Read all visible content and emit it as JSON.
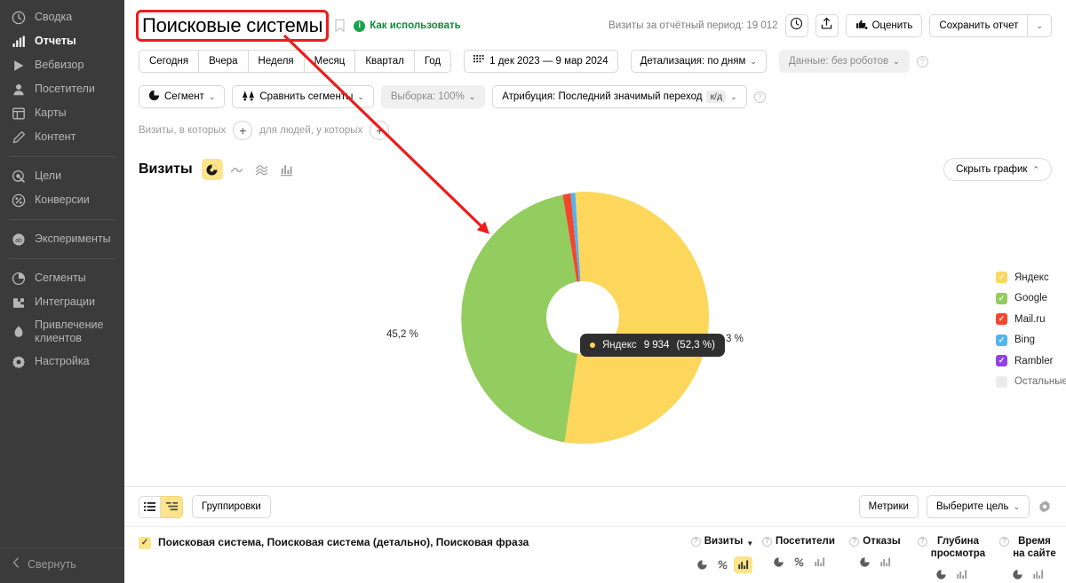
{
  "sidebar": {
    "groups": [
      {
        "items": [
          {
            "label": "Сводка",
            "icon": "summary-icon",
            "active": false
          },
          {
            "label": "Отчеты",
            "icon": "reports-icon",
            "active": true
          },
          {
            "label": "Вебвизор",
            "icon": "webvisor-icon",
            "active": false
          },
          {
            "label": "Посетители",
            "icon": "visitors-icon",
            "active": false
          },
          {
            "label": "Карты",
            "icon": "maps-icon",
            "active": false
          },
          {
            "label": "Контент",
            "icon": "content-icon",
            "active": false
          }
        ]
      },
      {
        "items": [
          {
            "label": "Цели",
            "icon": "goals-icon",
            "active": false
          },
          {
            "label": "Конверсии",
            "icon": "conversions-icon",
            "active": false
          }
        ]
      },
      {
        "items": [
          {
            "label": "Эксперименты",
            "icon": "experiments-icon",
            "active": false
          }
        ]
      },
      {
        "items": [
          {
            "label": "Сегменты",
            "icon": "segments-icon",
            "active": false
          },
          {
            "label": "Интеграции",
            "icon": "integrations-icon",
            "active": false
          },
          {
            "label": "Привлечение\nклиентов",
            "icon": "acquisition-icon",
            "active": false
          },
          {
            "label": "Настройка",
            "icon": "settings-icon",
            "active": false
          }
        ]
      }
    ],
    "collapse_label": "Свернуть"
  },
  "header": {
    "title": "Поисковые системы",
    "title_highlighted": true,
    "bookmark_icon": "bookmark-icon",
    "howto_label": "Как использовать",
    "info_badge": "i",
    "visits_summary": "Визиты за отчётный период: 19 012",
    "history_icon": "clock-icon",
    "export_icon": "export-icon",
    "rate_label": "Оценить",
    "rate_icon": "thumbs-icon",
    "save_report_label": "Сохранить отчет",
    "save_report_caret": "⌄"
  },
  "toolbar": {
    "periods": [
      "Сегодня",
      "Вчера",
      "Неделя",
      "Месяц",
      "Квартал",
      "Год"
    ],
    "date_range": "1 дек 2023 — 9 мар 2024",
    "date_icon": "calendar-icon",
    "detail_label": "Детализация: по дням",
    "data_label": "Данные: без роботов",
    "help_icon": "question-icon"
  },
  "segments": {
    "segment_label": "Сегмент",
    "segment_icon": "segment-pie-icon",
    "compare_label": "Сравнить сегменты",
    "compare_icon": "compare-icon",
    "sample_label": "Выборка: 100%",
    "attribution_label": "Атрибуция: Последний значимый переход",
    "attribution_chip": "к/д",
    "help_icon": "question-icon",
    "filter_visits_label": "Визиты, в которых",
    "filter_people_label": "для людей, у которых",
    "add_icon": "plus-icon"
  },
  "chart_header": {
    "metric_label": "Визиты",
    "viz_modes": [
      {
        "name": "pie-chart-icon",
        "active": true
      },
      {
        "name": "line-chart-icon",
        "active": false
      },
      {
        "name": "area-chart-icon",
        "active": false
      },
      {
        "name": "bar-chart-icon",
        "active": false
      }
    ],
    "hide_chart_label": "Скрыть график",
    "hide_chart_caret": "⌃"
  },
  "chart_data": {
    "type": "pie",
    "title": "Визиты",
    "variant": "donut",
    "total_visits": 19012,
    "categories": [
      "Яндекс",
      "Google",
      "Mail.ru",
      "Bing",
      "Rambler",
      "Остальные"
    ],
    "values": [
      9934,
      8593,
      190,
      114,
      0,
      0
    ],
    "percents": [
      52.3,
      45.2,
      1.0,
      0.6,
      0.0,
      0.0
    ],
    "colors": [
      "#fcd75c",
      "#93cc5f",
      "#f4462d",
      "#53b4f0",
      "#9341e8",
      "#e8e8e8"
    ],
    "enabled": [
      true,
      true,
      true,
      true,
      true,
      false
    ],
    "visible_labels": [
      {
        "text": "52,3 %",
        "slice": "Яндекс"
      },
      {
        "text": "45,2 %",
        "slice": "Google"
      }
    ],
    "tooltip": {
      "series": "Яндекс",
      "value": "9 934",
      "percent": "(52,3 %)"
    },
    "legend_position": "right"
  },
  "table": {
    "view_modes": [
      {
        "name": "list-view-icon",
        "active": false
      },
      {
        "name": "tree-view-icon",
        "active": true
      }
    ],
    "groupings_label": "Группировки",
    "metrics_label": "Метрики",
    "goal_label": "Выберите цель",
    "gear_icon": "gear-icon",
    "dimension_row": "Поисковая система, Поисковая система (детально), Поисковая фраза",
    "dimension_checked": true,
    "metric_columns": [
      {
        "label": "Визиты",
        "sorted": true,
        "sort_arrow": "▼",
        "icons": [
          {
            "name": "pie-icon",
            "active": false
          },
          {
            "name": "percent-icon",
            "active": false
          },
          {
            "name": "bars-icon",
            "active": true
          }
        ]
      },
      {
        "label": "Посетители",
        "sorted": false,
        "sort_arrow": "",
        "icons": [
          {
            "name": "pie-icon",
            "active": false
          },
          {
            "name": "percent-icon",
            "active": false
          },
          {
            "name": "bars-icon",
            "active": false
          }
        ]
      },
      {
        "label": "Отказы",
        "sorted": false,
        "sort_arrow": "",
        "icons": [
          {
            "name": "pie-icon",
            "active": false
          },
          {
            "name": "bars-icon",
            "active": false
          }
        ]
      },
      {
        "label": "Глубина\nпросмотра",
        "sorted": false,
        "sort_arrow": "",
        "icons": [
          {
            "name": "pie-icon",
            "active": false
          },
          {
            "name": "bars-icon",
            "active": false
          }
        ]
      },
      {
        "label": "Время\nна сайте",
        "sorted": false,
        "sort_arrow": "",
        "icons": [
          {
            "name": "pie-icon",
            "active": false
          },
          {
            "name": "bars-icon",
            "active": false
          }
        ]
      }
    ]
  },
  "annotation": {
    "arrow_color": "#ee1c1c",
    "box_color": "#ee1c1c"
  }
}
